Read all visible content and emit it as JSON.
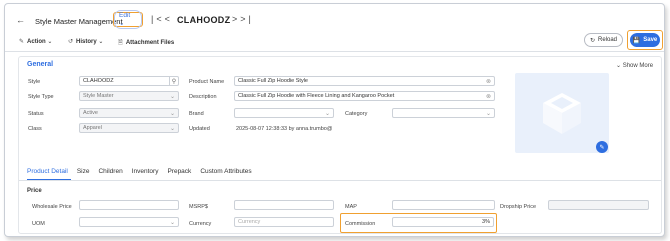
{
  "header": {
    "back_icon": "arrow-left-icon",
    "title": "Style Master Management",
    "edit_label": "Edit",
    "record_id": "CLAHOODZ"
  },
  "toolbar": {
    "action_label": "Action",
    "history_label": "History",
    "attachment_label": "Attachment Files",
    "reload_label": "Reload",
    "save_label": "Save"
  },
  "general": {
    "title": "General",
    "show_more": "Show More",
    "style": {
      "label": "Style",
      "value": "CLAHOODZ"
    },
    "style_type": {
      "label": "Style Type",
      "value": "Style Master"
    },
    "status": {
      "label": "Status",
      "value": "Active"
    },
    "class": {
      "label": "Class",
      "value": "Apparel"
    },
    "product_name": {
      "label": "Product Name",
      "value": "Classic Full Zip Hoodie Style"
    },
    "description": {
      "label": "Description",
      "value": "Classic Full Zip Hoodie with Fleece Lining and Kangaroo Pocket"
    },
    "brand": {
      "label": "Brand",
      "value": ""
    },
    "category": {
      "label": "Category",
      "value": ""
    },
    "updated": {
      "label": "Updated",
      "value": "2025-08-07 12:38:33 by anna.trumbo@"
    }
  },
  "tabs": [
    "Product Detail",
    "Size",
    "Children",
    "Inventory",
    "Prepack",
    "Custom Attributes"
  ],
  "price": {
    "title": "Price",
    "wholesale_price": {
      "label": "Wholesale Price",
      "value": ""
    },
    "msrp": {
      "label": "MSRP$",
      "value": ""
    },
    "map": {
      "label": "MAP",
      "value": ""
    },
    "dropship_price": {
      "label": "Dropship Price",
      "value": ""
    },
    "uom": {
      "label": "UOM",
      "value": ""
    },
    "currency": {
      "label": "Currency",
      "placeholder": "Currency"
    },
    "commission": {
      "label": "Commission",
      "value": "3%"
    }
  },
  "colors": {
    "accent": "#2e6ee0",
    "highlight": "#f0a030"
  }
}
